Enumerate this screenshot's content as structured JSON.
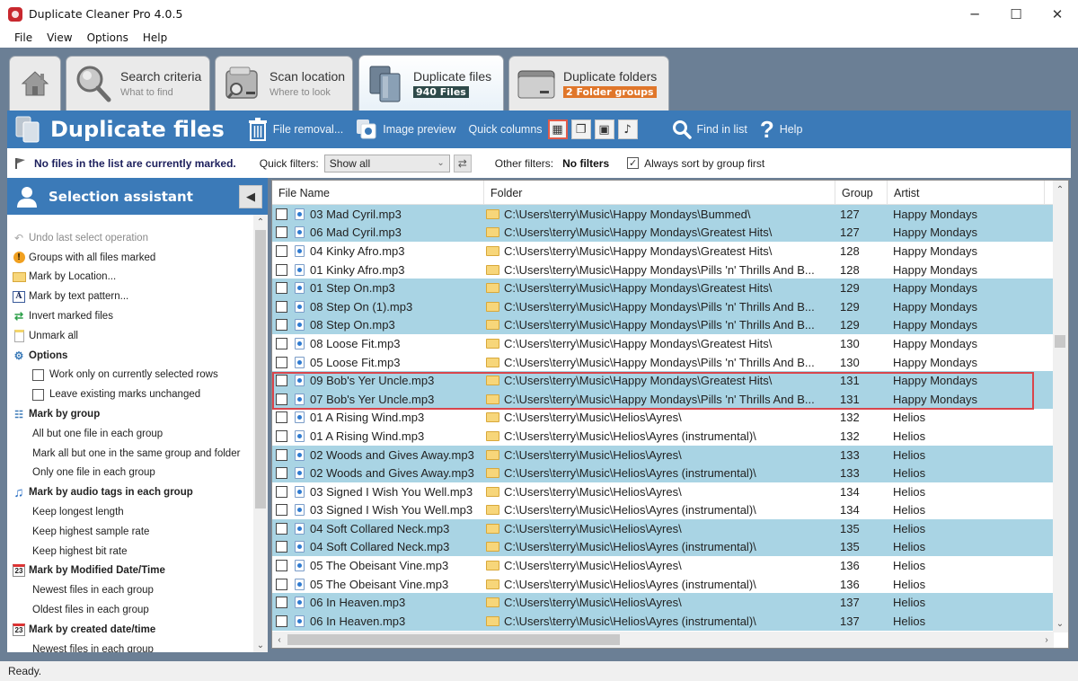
{
  "window": {
    "title": "Duplicate Cleaner Pro 4.0.5",
    "controls": {
      "minimize": "─",
      "maximize": "☐",
      "close": "✕"
    }
  },
  "menu": [
    "File",
    "View",
    "Options",
    "Help"
  ],
  "tabs": [
    {
      "id": "home",
      "icon": "home-icon"
    },
    {
      "id": "search",
      "title": "Search criteria",
      "subtitle": "What to find",
      "icon": "magnifier-icon"
    },
    {
      "id": "scan",
      "title": "Scan location",
      "subtitle": "Where to look",
      "icon": "scan-folder-icon"
    },
    {
      "id": "dupfiles",
      "title": "Duplicate files",
      "badge": "940 Files",
      "icon": "duplicate-files-icon",
      "active": true
    },
    {
      "id": "dupfolders",
      "title": "Duplicate folders",
      "badge": "2 Folder groups",
      "icon": "folder-icon"
    }
  ],
  "toolbar": {
    "title": "Duplicate files",
    "file_removal": "File removal...",
    "image_preview": "Image preview",
    "quick_columns": "Quick columns",
    "find_in_list": "Find in list",
    "help": "Help"
  },
  "filters": {
    "marked_status": "No files in the list are currently marked.",
    "quick_filters_label": "Quick filters:",
    "quick_filters_value": "Show all",
    "other_filters_label": "Other filters:",
    "other_filters_value": "No filters",
    "sort_by_group_label": "Always sort by group first",
    "sort_by_group_checked": true
  },
  "selection_assistant": {
    "title": "Selection assistant",
    "items": [
      {
        "label": "Undo last select operation",
        "type": "action",
        "icon": "undo-icon",
        "disabled": true
      },
      {
        "label": "Groups with all files marked",
        "type": "action",
        "icon": "warning-icon"
      },
      {
        "label": "Mark by Location...",
        "type": "action",
        "icon": "folder-icon"
      },
      {
        "label": "Mark by text pattern...",
        "type": "action",
        "icon": "text-pattern-icon"
      },
      {
        "label": "Invert marked files",
        "type": "action",
        "icon": "invert-icon"
      },
      {
        "label": "Unmark all",
        "type": "action",
        "icon": "unmark-icon"
      },
      {
        "label": "Options",
        "type": "heading",
        "icon": "options-icon"
      },
      {
        "label": "Work only on currently selected rows",
        "type": "option",
        "checked": false
      },
      {
        "label": "Leave existing marks unchanged",
        "type": "option",
        "checked": false
      },
      {
        "label": "Mark by group",
        "type": "heading",
        "icon": "group-tree-icon"
      },
      {
        "label": "All but one file in each group",
        "type": "sub"
      },
      {
        "label": "Mark all but one in the same group and folder",
        "type": "sub"
      },
      {
        "label": "Only one file in each group",
        "type": "sub"
      },
      {
        "label": "Mark by audio tags in each group",
        "type": "heading",
        "icon": "music-note-icon"
      },
      {
        "label": "Keep longest length",
        "type": "sub"
      },
      {
        "label": "Keep highest sample rate",
        "type": "sub"
      },
      {
        "label": "Keep highest bit rate",
        "type": "sub"
      },
      {
        "label": "Mark by Modified Date/Time",
        "type": "heading",
        "icon": "calendar-icon"
      },
      {
        "label": "Newest files in each group",
        "type": "sub"
      },
      {
        "label": "Oldest files in each group",
        "type": "sub"
      },
      {
        "label": "Mark by created date/time",
        "type": "heading",
        "icon": "calendar-icon"
      },
      {
        "label": "Newest files in each group",
        "type": "sub"
      }
    ]
  },
  "grid": {
    "columns": [
      "File Name",
      "Folder",
      "Group",
      "Artist"
    ],
    "rows": [
      {
        "name": "03 Mad Cyril.mp3",
        "folder": "C:\\Users\\terry\\Music\\Happy Mondays\\Bummed\\",
        "group": "127",
        "artist": "Happy Mondays",
        "blue": true
      },
      {
        "name": "06 Mad Cyril.mp3",
        "folder": "C:\\Users\\terry\\Music\\Happy Mondays\\Greatest Hits\\",
        "group": "127",
        "artist": "Happy Mondays",
        "blue": true
      },
      {
        "name": "04 Kinky Afro.mp3",
        "folder": "C:\\Users\\terry\\Music\\Happy Mondays\\Greatest Hits\\",
        "group": "128",
        "artist": "Happy Mondays",
        "blue": false
      },
      {
        "name": "01 Kinky Afro.mp3",
        "folder": "C:\\Users\\terry\\Music\\Happy Mondays\\Pills 'n' Thrills And B...",
        "group": "128",
        "artist": "Happy Mondays",
        "blue": false
      },
      {
        "name": "01 Step On.mp3",
        "folder": "C:\\Users\\terry\\Music\\Happy Mondays\\Greatest Hits\\",
        "group": "129",
        "artist": "Happy Mondays",
        "blue": true
      },
      {
        "name": "08 Step On (1).mp3",
        "folder": "C:\\Users\\terry\\Music\\Happy Mondays\\Pills 'n' Thrills And B...",
        "group": "129",
        "artist": "Happy Mondays",
        "blue": true
      },
      {
        "name": "08 Step On.mp3",
        "folder": "C:\\Users\\terry\\Music\\Happy Mondays\\Pills 'n' Thrills And B...",
        "group": "129",
        "artist": "Happy Mondays",
        "blue": true
      },
      {
        "name": "08 Loose Fit.mp3",
        "folder": "C:\\Users\\terry\\Music\\Happy Mondays\\Greatest Hits\\",
        "group": "130",
        "artist": "Happy Mondays",
        "blue": false
      },
      {
        "name": "05 Loose Fit.mp3",
        "folder": "C:\\Users\\terry\\Music\\Happy Mondays\\Pills 'n' Thrills And B...",
        "group": "130",
        "artist": "Happy Mondays",
        "blue": false
      },
      {
        "name": "09 Bob's Yer Uncle.mp3",
        "folder": "C:\\Users\\terry\\Music\\Happy Mondays\\Greatest Hits\\",
        "group": "131",
        "artist": "Happy Mondays",
        "blue": true
      },
      {
        "name": "07 Bob's Yer Uncle.mp3",
        "folder": "C:\\Users\\terry\\Music\\Happy Mondays\\Pills 'n' Thrills And B...",
        "group": "131",
        "artist": "Happy Mondays",
        "blue": true
      },
      {
        "name": "01 A Rising Wind.mp3",
        "folder": "C:\\Users\\terry\\Music\\Helios\\Ayres\\",
        "group": "132",
        "artist": "Helios",
        "blue": false
      },
      {
        "name": "01 A Rising Wind.mp3",
        "folder": "C:\\Users\\terry\\Music\\Helios\\Ayres (instrumental)\\",
        "group": "132",
        "artist": "Helios",
        "blue": false
      },
      {
        "name": "02 Woods and Gives Away.mp3",
        "folder": "C:\\Users\\terry\\Music\\Helios\\Ayres\\",
        "group": "133",
        "artist": "Helios",
        "blue": true
      },
      {
        "name": "02 Woods and Gives Away.mp3",
        "folder": "C:\\Users\\terry\\Music\\Helios\\Ayres (instrumental)\\",
        "group": "133",
        "artist": "Helios",
        "blue": true
      },
      {
        "name": "03 Signed I Wish You Well.mp3",
        "folder": "C:\\Users\\terry\\Music\\Helios\\Ayres\\",
        "group": "134",
        "artist": "Helios",
        "blue": false
      },
      {
        "name": "03 Signed I Wish You Well.mp3",
        "folder": "C:\\Users\\terry\\Music\\Helios\\Ayres (instrumental)\\",
        "group": "134",
        "artist": "Helios",
        "blue": false
      },
      {
        "name": "04 Soft Collared Neck.mp3",
        "folder": "C:\\Users\\terry\\Music\\Helios\\Ayres\\",
        "group": "135",
        "artist": "Helios",
        "blue": true
      },
      {
        "name": "04 Soft Collared Neck.mp3",
        "folder": "C:\\Users\\terry\\Music\\Helios\\Ayres (instrumental)\\",
        "group": "135",
        "artist": "Helios",
        "blue": true
      },
      {
        "name": "05 The Obeisant Vine.mp3",
        "folder": "C:\\Users\\terry\\Music\\Helios\\Ayres\\",
        "group": "136",
        "artist": "Helios",
        "blue": false
      },
      {
        "name": "05 The Obeisant Vine.mp3",
        "folder": "C:\\Users\\terry\\Music\\Helios\\Ayres (instrumental)\\",
        "group": "136",
        "artist": "Helios",
        "blue": false
      },
      {
        "name": "06 In Heaven.mp3",
        "folder": "C:\\Users\\terry\\Music\\Helios\\Ayres\\",
        "group": "137",
        "artist": "Helios",
        "blue": true
      },
      {
        "name": "06 In Heaven.mp3",
        "folder": "C:\\Users\\terry\\Music\\Helios\\Ayres (instrumental)\\",
        "group": "137",
        "artist": "Helios",
        "blue": true
      }
    ]
  },
  "colors": {
    "accent_blue": "#3b7ab8",
    "row_highlight": "#a9d4e4",
    "annotation_red": "#d9454c",
    "badge_orange": "#e0762a",
    "badge_dark": "#2e4a4a"
  },
  "status": "Ready."
}
